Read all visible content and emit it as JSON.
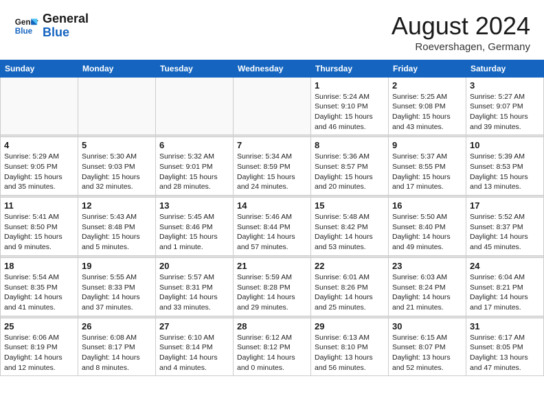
{
  "header": {
    "logo_line1": "General",
    "logo_line2": "Blue",
    "main_title": "August 2024",
    "subtitle": "Roevershagen, Germany"
  },
  "days_of_week": [
    "Sunday",
    "Monday",
    "Tuesday",
    "Wednesday",
    "Thursday",
    "Friday",
    "Saturday"
  ],
  "weeks": [
    {
      "days": [
        {
          "num": "",
          "info": "",
          "empty": true
        },
        {
          "num": "",
          "info": "",
          "empty": true
        },
        {
          "num": "",
          "info": "",
          "empty": true
        },
        {
          "num": "",
          "info": "",
          "empty": true
        },
        {
          "num": "1",
          "info": "Sunrise: 5:24 AM\nSunset: 9:10 PM\nDaylight: 15 hours\nand 46 minutes."
        },
        {
          "num": "2",
          "info": "Sunrise: 5:25 AM\nSunset: 9:08 PM\nDaylight: 15 hours\nand 43 minutes."
        },
        {
          "num": "3",
          "info": "Sunrise: 5:27 AM\nSunset: 9:07 PM\nDaylight: 15 hours\nand 39 minutes."
        }
      ]
    },
    {
      "days": [
        {
          "num": "4",
          "info": "Sunrise: 5:29 AM\nSunset: 9:05 PM\nDaylight: 15 hours\nand 35 minutes."
        },
        {
          "num": "5",
          "info": "Sunrise: 5:30 AM\nSunset: 9:03 PM\nDaylight: 15 hours\nand 32 minutes."
        },
        {
          "num": "6",
          "info": "Sunrise: 5:32 AM\nSunset: 9:01 PM\nDaylight: 15 hours\nand 28 minutes."
        },
        {
          "num": "7",
          "info": "Sunrise: 5:34 AM\nSunset: 8:59 PM\nDaylight: 15 hours\nand 24 minutes."
        },
        {
          "num": "8",
          "info": "Sunrise: 5:36 AM\nSunset: 8:57 PM\nDaylight: 15 hours\nand 20 minutes."
        },
        {
          "num": "9",
          "info": "Sunrise: 5:37 AM\nSunset: 8:55 PM\nDaylight: 15 hours\nand 17 minutes."
        },
        {
          "num": "10",
          "info": "Sunrise: 5:39 AM\nSunset: 8:53 PM\nDaylight: 15 hours\nand 13 minutes."
        }
      ]
    },
    {
      "days": [
        {
          "num": "11",
          "info": "Sunrise: 5:41 AM\nSunset: 8:50 PM\nDaylight: 15 hours\nand 9 minutes."
        },
        {
          "num": "12",
          "info": "Sunrise: 5:43 AM\nSunset: 8:48 PM\nDaylight: 15 hours\nand 5 minutes."
        },
        {
          "num": "13",
          "info": "Sunrise: 5:45 AM\nSunset: 8:46 PM\nDaylight: 15 hours\nand 1 minute."
        },
        {
          "num": "14",
          "info": "Sunrise: 5:46 AM\nSunset: 8:44 PM\nDaylight: 14 hours\nand 57 minutes."
        },
        {
          "num": "15",
          "info": "Sunrise: 5:48 AM\nSunset: 8:42 PM\nDaylight: 14 hours\nand 53 minutes."
        },
        {
          "num": "16",
          "info": "Sunrise: 5:50 AM\nSunset: 8:40 PM\nDaylight: 14 hours\nand 49 minutes."
        },
        {
          "num": "17",
          "info": "Sunrise: 5:52 AM\nSunset: 8:37 PM\nDaylight: 14 hours\nand 45 minutes."
        }
      ]
    },
    {
      "days": [
        {
          "num": "18",
          "info": "Sunrise: 5:54 AM\nSunset: 8:35 PM\nDaylight: 14 hours\nand 41 minutes."
        },
        {
          "num": "19",
          "info": "Sunrise: 5:55 AM\nSunset: 8:33 PM\nDaylight: 14 hours\nand 37 minutes."
        },
        {
          "num": "20",
          "info": "Sunrise: 5:57 AM\nSunset: 8:31 PM\nDaylight: 14 hours\nand 33 minutes."
        },
        {
          "num": "21",
          "info": "Sunrise: 5:59 AM\nSunset: 8:28 PM\nDaylight: 14 hours\nand 29 minutes."
        },
        {
          "num": "22",
          "info": "Sunrise: 6:01 AM\nSunset: 8:26 PM\nDaylight: 14 hours\nand 25 minutes."
        },
        {
          "num": "23",
          "info": "Sunrise: 6:03 AM\nSunset: 8:24 PM\nDaylight: 14 hours\nand 21 minutes."
        },
        {
          "num": "24",
          "info": "Sunrise: 6:04 AM\nSunset: 8:21 PM\nDaylight: 14 hours\nand 17 minutes."
        }
      ]
    },
    {
      "days": [
        {
          "num": "25",
          "info": "Sunrise: 6:06 AM\nSunset: 8:19 PM\nDaylight: 14 hours\nand 12 minutes."
        },
        {
          "num": "26",
          "info": "Sunrise: 6:08 AM\nSunset: 8:17 PM\nDaylight: 14 hours\nand 8 minutes."
        },
        {
          "num": "27",
          "info": "Sunrise: 6:10 AM\nSunset: 8:14 PM\nDaylight: 14 hours\nand 4 minutes."
        },
        {
          "num": "28",
          "info": "Sunrise: 6:12 AM\nSunset: 8:12 PM\nDaylight: 14 hours\nand 0 minutes."
        },
        {
          "num": "29",
          "info": "Sunrise: 6:13 AM\nSunset: 8:10 PM\nDaylight: 13 hours\nand 56 minutes."
        },
        {
          "num": "30",
          "info": "Sunrise: 6:15 AM\nSunset: 8:07 PM\nDaylight: 13 hours\nand 52 minutes."
        },
        {
          "num": "31",
          "info": "Sunrise: 6:17 AM\nSunset: 8:05 PM\nDaylight: 13 hours\nand 47 minutes."
        }
      ]
    }
  ]
}
